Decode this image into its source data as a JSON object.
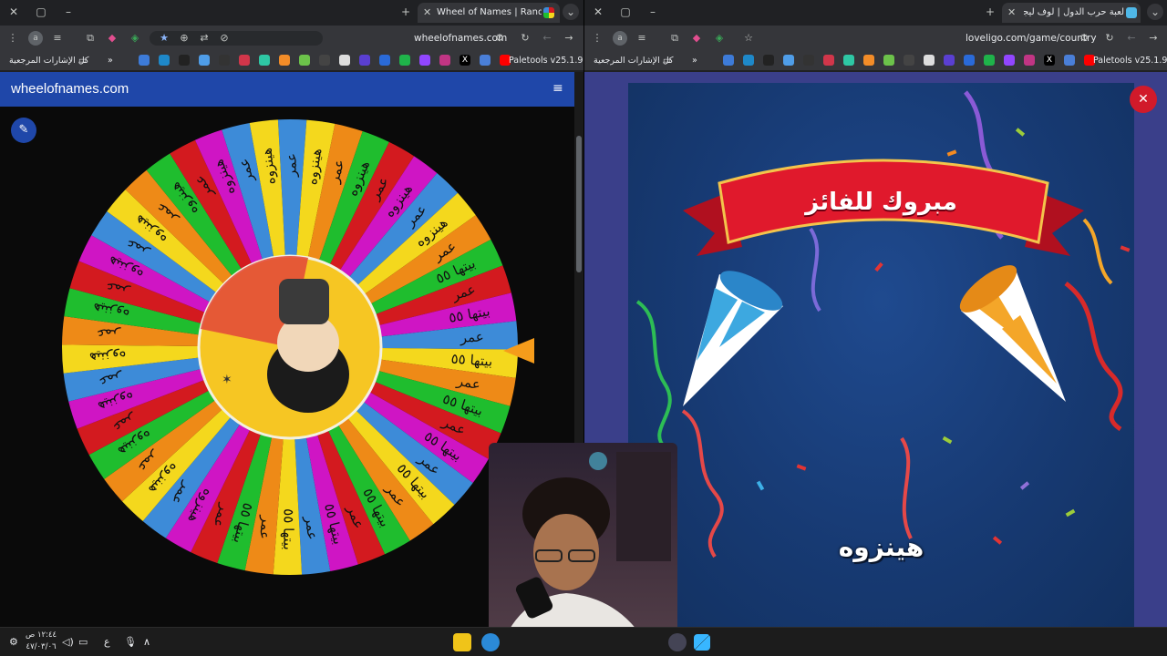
{
  "left_browser": {
    "tab_title": "Wheel of Names | Random nam",
    "url": "wheelofnames.com",
    "bookmarks_folder": "كل الإشارات المرجعية",
    "bookmarks_more": "»",
    "paletools": "Paletools v25.1.9"
  },
  "right_browser": {
    "tab_title": "لعبة حرب الدول | لوف ليجو يوفر",
    "url": "loveligo.com/game/country",
    "bookmarks_folder": "كل الإشارات المرجعية",
    "bookmarks_more": "»",
    "paletools": "Paletools v25.1.9"
  },
  "wheel_page": {
    "site_title": "wheelofnames.com",
    "wheel": {
      "names": [
        "عمر",
        "هينزوه",
        "بيتها ٥٥"
      ],
      "segment_pattern": [
        0,
        1,
        0,
        1,
        0,
        1,
        0,
        1,
        0,
        2,
        0,
        2,
        0,
        2,
        0,
        2,
        0,
        2,
        0,
        2,
        0,
        2,
        0,
        2,
        0,
        2,
        0,
        2,
        0,
        1,
        0,
        1,
        0,
        1,
        0,
        1,
        0,
        1,
        0,
        1,
        0,
        1,
        0,
        1,
        0,
        1,
        0,
        1,
        0,
        1
      ],
      "colors": [
        "#3d8bd8",
        "#f4d81d",
        "#ee8a17",
        "#1fbd2e",
        "#d31a1f",
        "#cf15c4"
      ],
      "rotation_deg": -3
    }
  },
  "celebration": {
    "banner": "مبروك للفائز",
    "winner": "هينزوه"
  },
  "taskbar": {
    "time": "١٢:٤٤ ص",
    "date": "٤٧/٠٣/٠٦",
    "lang": "ع"
  }
}
